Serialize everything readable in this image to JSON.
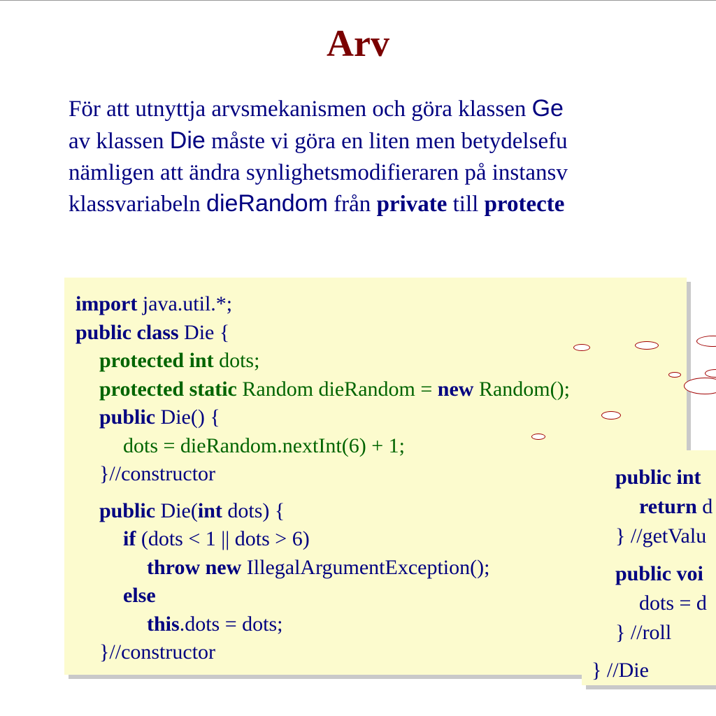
{
  "title": "Arv",
  "para": {
    "t1": "För att utnyttja arvsmekanismen och göra klassen ",
    "cls1": "Ge",
    "t2": "av klassen ",
    "cls2": "Die",
    "t3": " måste vi göra en liten men betydelsefu",
    "t4": "nämligen att ändra synlighetsmodifieraren på instansv",
    "t5": "klassvariabeln ",
    "var1": "dieRandom",
    "t6": " från ",
    "b1": "private",
    "t7": " till ",
    "b2": "protecte"
  },
  "code1": {
    "l1a": "import",
    "l1b": " java.util.*;",
    "l2a": "public class",
    "l2b": " Die {",
    "l3a": "protected int",
    "l3b": " dots;",
    "l4a": "protected static",
    "l4b": " Random dieRandom  = ",
    "l4c": "new",
    "l4d": " Random();",
    "l5a": "public",
    "l5b": " Die() {",
    "l6": "dots = dieRandom.nextInt(6) + 1;",
    "l7": "}//constructor",
    "l8a": "public",
    "l8b": " Die(",
    "l8c": "int",
    "l8d": " dots) {",
    "l9a": "if",
    "l9b": " (dots < 1 || dots > 6)",
    "l10a": "throw new",
    "l10b": " IllegalArgumentException();",
    "l11": "else",
    "l12a": "this",
    "l12b": ".dots = dots;",
    "l13": "}//constructor"
  },
  "code2": {
    "l1": "public int",
    "l2a": "return",
    "l2b": " d",
    "l3": "} //getValu",
    "l4": "public voi",
    "l5": "dots = d",
    "l6": "} //roll",
    "l7": "} //Die"
  }
}
